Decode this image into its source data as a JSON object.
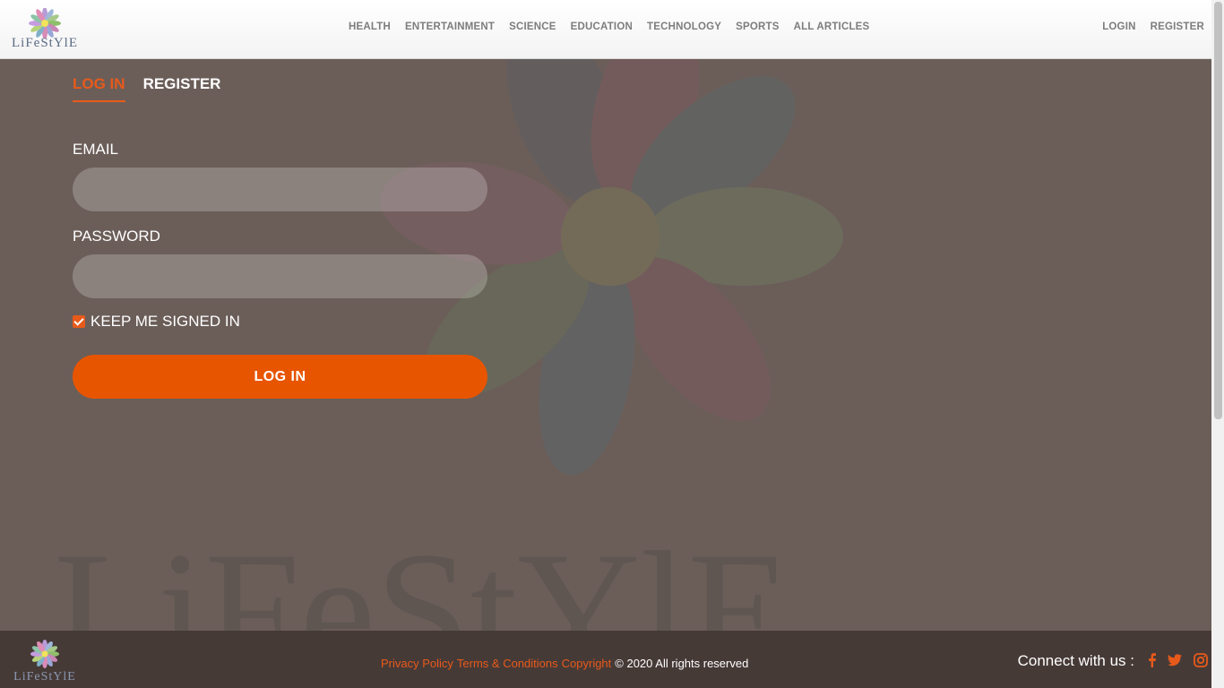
{
  "brand": {
    "logo_text": "LiFeStYlE",
    "watermark_text": "LiFeStYlE"
  },
  "nav": {
    "items": [
      "HEALTH",
      "ENTERTAINMENT",
      "SCIENCE",
      "EDUCATION",
      "TECHNOLOGY",
      "SPORTS",
      "ALL ARTICLES"
    ]
  },
  "auth": {
    "login": "LOGIN",
    "register": "REGISTER"
  },
  "form": {
    "tabs": {
      "login": "LOG IN",
      "register": "REGISTER"
    },
    "email_label": "EMAIL",
    "email_value": "",
    "password_label": "PASSWORD",
    "password_value": "",
    "keep_signed_in_label": "KEEP ME SIGNED IN",
    "keep_signed_in_checked": true,
    "submit_label": "LOG IN"
  },
  "footer": {
    "privacy": "Privacy Policy",
    "terms": "Terms & Conditions",
    "copyright_link": "Copyright",
    "copyright_text": "© 2020 All rights reserved",
    "connect": "Connect with us :",
    "social_icons": [
      "facebook-icon",
      "twitter-icon",
      "instagram-icon"
    ]
  },
  "colors": {
    "accent": "#e85500",
    "background": "#6b5e59",
    "footer": "#463a37"
  }
}
